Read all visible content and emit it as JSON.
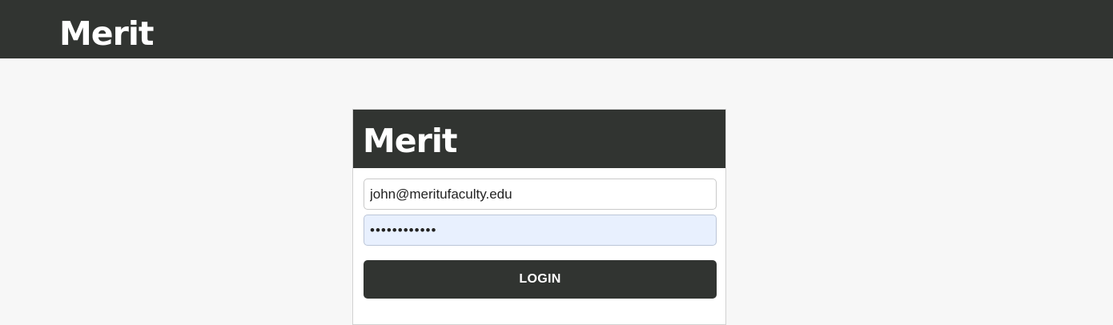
{
  "header": {
    "logo_text": "Merit"
  },
  "login_card": {
    "logo_text": "Merit",
    "email": {
      "value": "john@meritufaculty.edu"
    },
    "password": {
      "value": "************"
    },
    "login_button_label": "LOGIN"
  },
  "colors": {
    "header_bg": "#313431",
    "page_bg": "#f7f7f7",
    "button_bg": "#313431",
    "autofill_bg": "#e8f0fe"
  }
}
